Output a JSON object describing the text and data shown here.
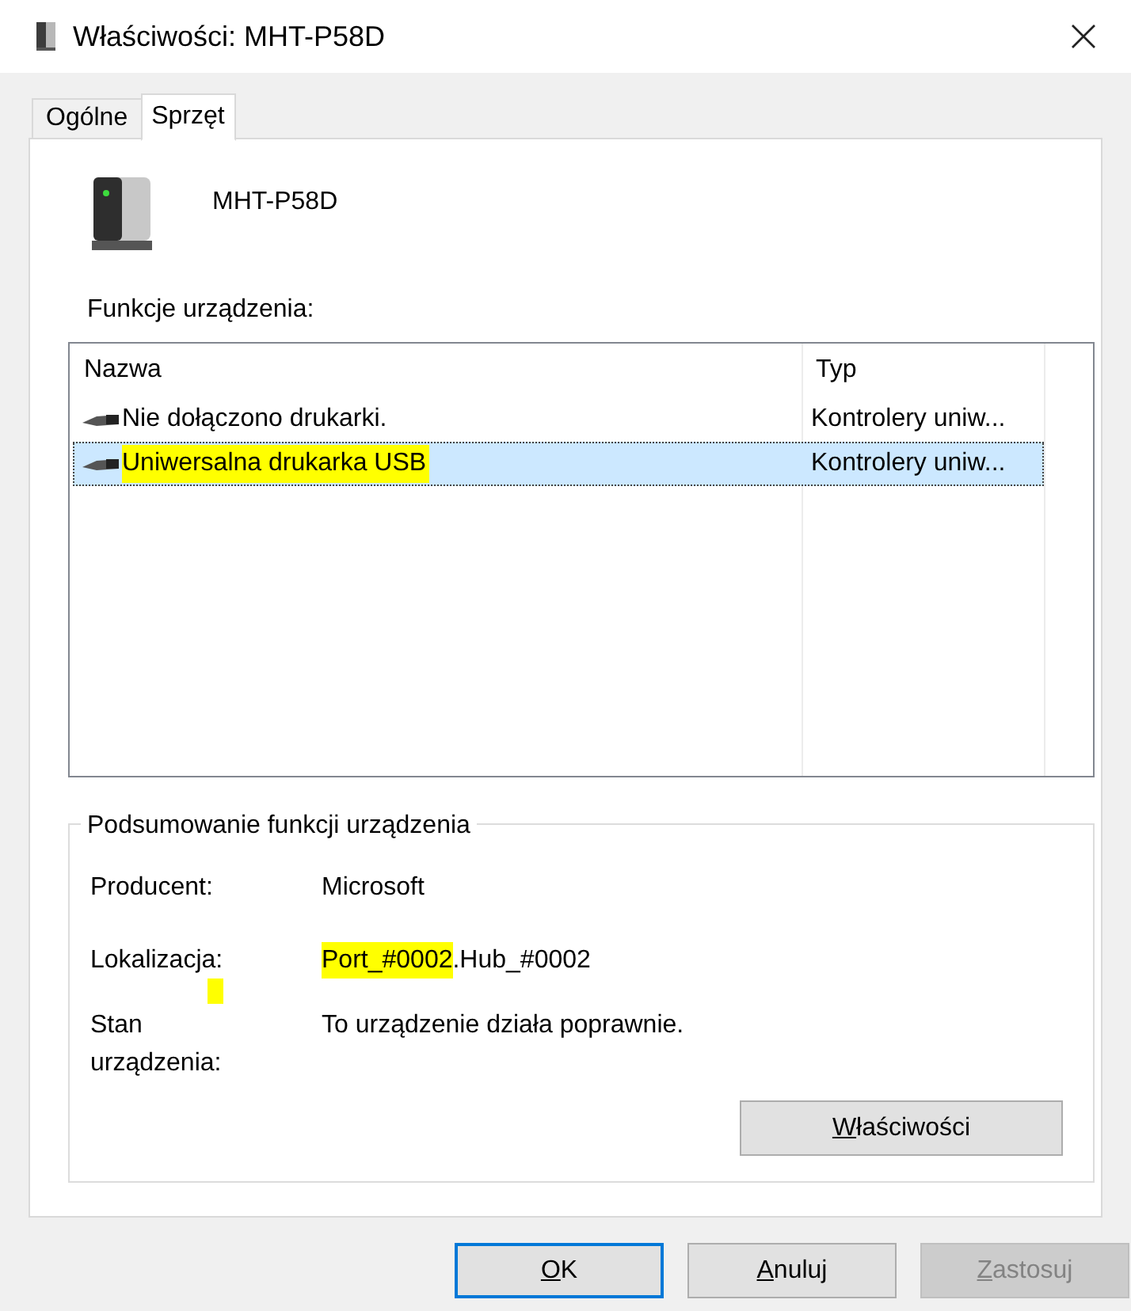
{
  "window": {
    "title": "Właściwości: MHT-P58D"
  },
  "tabs": [
    {
      "label": "Ogólne",
      "selected": false
    },
    {
      "label": "Sprzęt",
      "selected": true
    }
  ],
  "device": {
    "name": "MHT-P58D"
  },
  "functions": {
    "label": "Funkcje urządzenia:",
    "columns": [
      "Nazwa",
      "Typ"
    ],
    "rows": [
      {
        "name": "Nie dołączono drukarki.",
        "type": "Kontrolery uniw...",
        "selected": false,
        "highlighted": false
      },
      {
        "name": "Uniwersalna drukarka USB",
        "type": "Kontrolery uniw...",
        "selected": true,
        "highlighted": true
      }
    ]
  },
  "summary": {
    "title": "Podsumowanie funkcji urządzenia",
    "manufacturer": {
      "label": "Producent:",
      "value": "Microsoft"
    },
    "location": {
      "label": "Lokalizacja:",
      "highlighted_part": "Port_#0002",
      "rest": ".Hub_#0002"
    },
    "status": {
      "label": "Stan urządzenia:",
      "value": "To urządzenie działa poprawnie."
    },
    "stray_highlight": true,
    "button": "Właściwości"
  },
  "buttons": [
    {
      "label": "OK",
      "default": true,
      "disabled": false
    },
    {
      "label": "Anuluj",
      "default": false,
      "disabled": false
    },
    {
      "label": "Zastosuj",
      "default": false,
      "disabled": true
    }
  ]
}
